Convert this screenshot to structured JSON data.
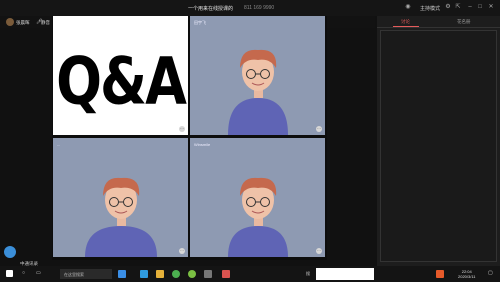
{
  "window": {
    "title": "一个用来在线授课的",
    "meeting_id": "811 169 9990",
    "mode_label": "主持模式"
  },
  "toolbar": {
    "user_name": "张晨晖",
    "mic_label": "静音"
  },
  "tiles": [
    {
      "id": "qa",
      "kind": "slide",
      "text": "Q&A",
      "tag": ""
    },
    {
      "id": "p1",
      "kind": "person",
      "tag": "田宇飞"
    },
    {
      "id": "p2",
      "kind": "person",
      "tag": "..."
    },
    {
      "id": "p3",
      "kind": "person",
      "tag": "Winsmile"
    }
  ],
  "panel": {
    "tabs": [
      "讨论",
      "花名册"
    ],
    "active_tab": 0
  },
  "bottom": {
    "call_label": "中通讯录"
  },
  "taskbar": {
    "search_placeholder": "在这里搜索",
    "label": "搜",
    "time": "22:04",
    "date": "2020/3/11"
  },
  "colors": {
    "tile_bg": "#8e9ab2",
    "accent": "#e45b5b",
    "shirt": "#5f64b5",
    "hair": "#c5694d"
  }
}
